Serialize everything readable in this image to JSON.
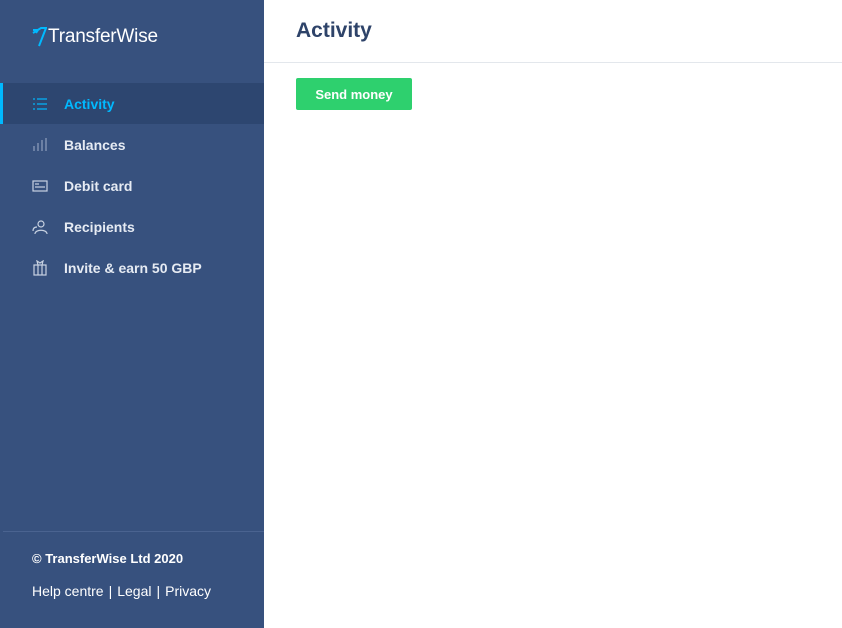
{
  "brand": {
    "name": "TransferWise",
    "accent": "#00b9ff"
  },
  "sidebar": {
    "items": [
      {
        "label": "Activity",
        "icon": "list-icon",
        "active": true
      },
      {
        "label": "Balances",
        "icon": "bar-chart-icon",
        "active": false
      },
      {
        "label": "Debit card",
        "icon": "card-icon",
        "active": false
      },
      {
        "label": "Recipients",
        "icon": "users-icon",
        "active": false
      },
      {
        "label": "Invite & earn 50 GBP",
        "icon": "gift-icon",
        "active": false
      }
    ],
    "footer": {
      "copyright": "© TransferWise Ltd 2020",
      "links": [
        "Help centre",
        "Legal",
        "Privacy"
      ],
      "separator": "|"
    }
  },
  "main": {
    "title": "Activity",
    "send_button": "Send money"
  },
  "colors": {
    "sidebar_bg": "#37517e",
    "active_bg": "#2d4670",
    "button_green": "#2ed06e",
    "title": "#2e4369"
  }
}
